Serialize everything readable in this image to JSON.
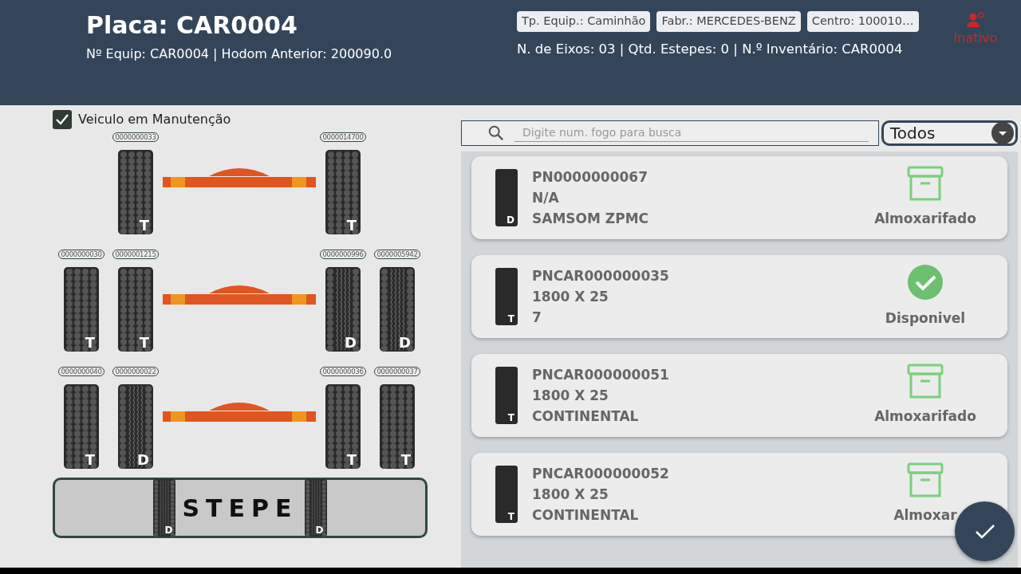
{
  "header": {
    "title": "Placa: CAR0004",
    "subtitle": "Nº Equip: CAR0004 | Hodom Anterior: 200090.0",
    "chips": [
      "Tp. Equip.: Caminhão",
      "Fabr.: MERCEDES-BENZ",
      "Centro: 100010…"
    ],
    "info": "N. de Eixos: 03 | Qtd. Estepes: 0 | N.º Inventário: CAR0004",
    "status": {
      "label": "Inativo",
      "active": false
    }
  },
  "maintenance": {
    "label": "Veiculo em Manutenção",
    "checked": true
  },
  "axles": [
    {
      "left": [
        {
          "label": "0000000033",
          "tread": "T",
          "kind": "dots"
        }
      ],
      "right": [
        {
          "label": "0000014700",
          "tread": "T",
          "kind": "dots"
        }
      ]
    },
    {
      "left": [
        {
          "label": "0000000030",
          "tread": "T",
          "kind": "dots"
        },
        {
          "label": "0000001215",
          "tread": "T",
          "kind": "dots"
        }
      ],
      "right": [
        {
          "label": "0000000996",
          "tread": "D",
          "kind": "waves"
        },
        {
          "label": "0000005942",
          "tread": "D",
          "kind": "waves"
        }
      ]
    },
    {
      "left": [
        {
          "label": "0000000040",
          "tread": "T",
          "kind": "dots"
        },
        {
          "label": "0000000022",
          "tread": "D",
          "kind": "waves"
        }
      ],
      "right": [
        {
          "label": "0000000036",
          "tread": "T",
          "kind": "dots"
        },
        {
          "label": "0000000037",
          "tread": "T",
          "kind": "dots"
        }
      ]
    }
  ],
  "spares": {
    "label": "STEPE",
    "tires": [
      {
        "tread": "D",
        "kind": "waves"
      },
      {
        "tread": "D",
        "kind": "waves"
      }
    ]
  },
  "search": {
    "placeholder": "Digite num. fogo para busca"
  },
  "filter": {
    "value": "Todos"
  },
  "tires": [
    {
      "code": "PN0000000067",
      "size": "N/A",
      "brand": "SAMSOM ZPMC",
      "tread": "D",
      "kind": "stored",
      "status": "Almoxarifado"
    },
    {
      "code": "PNCAR000000035",
      "size": "1800 X 25",
      "brand": "7",
      "tread": "T",
      "kind": "available",
      "status": "Disponivel"
    },
    {
      "code": "PNCAR000000051",
      "size": "1800 X 25",
      "brand": "CONTINENTAL",
      "tread": "T",
      "kind": "stored",
      "status": "Almoxarifado"
    },
    {
      "code": "PNCAR000000052",
      "size": "1800 X 25",
      "brand": "CONTINENTAL",
      "tread": "T",
      "kind": "stored",
      "status": "Almoxar"
    }
  ]
}
